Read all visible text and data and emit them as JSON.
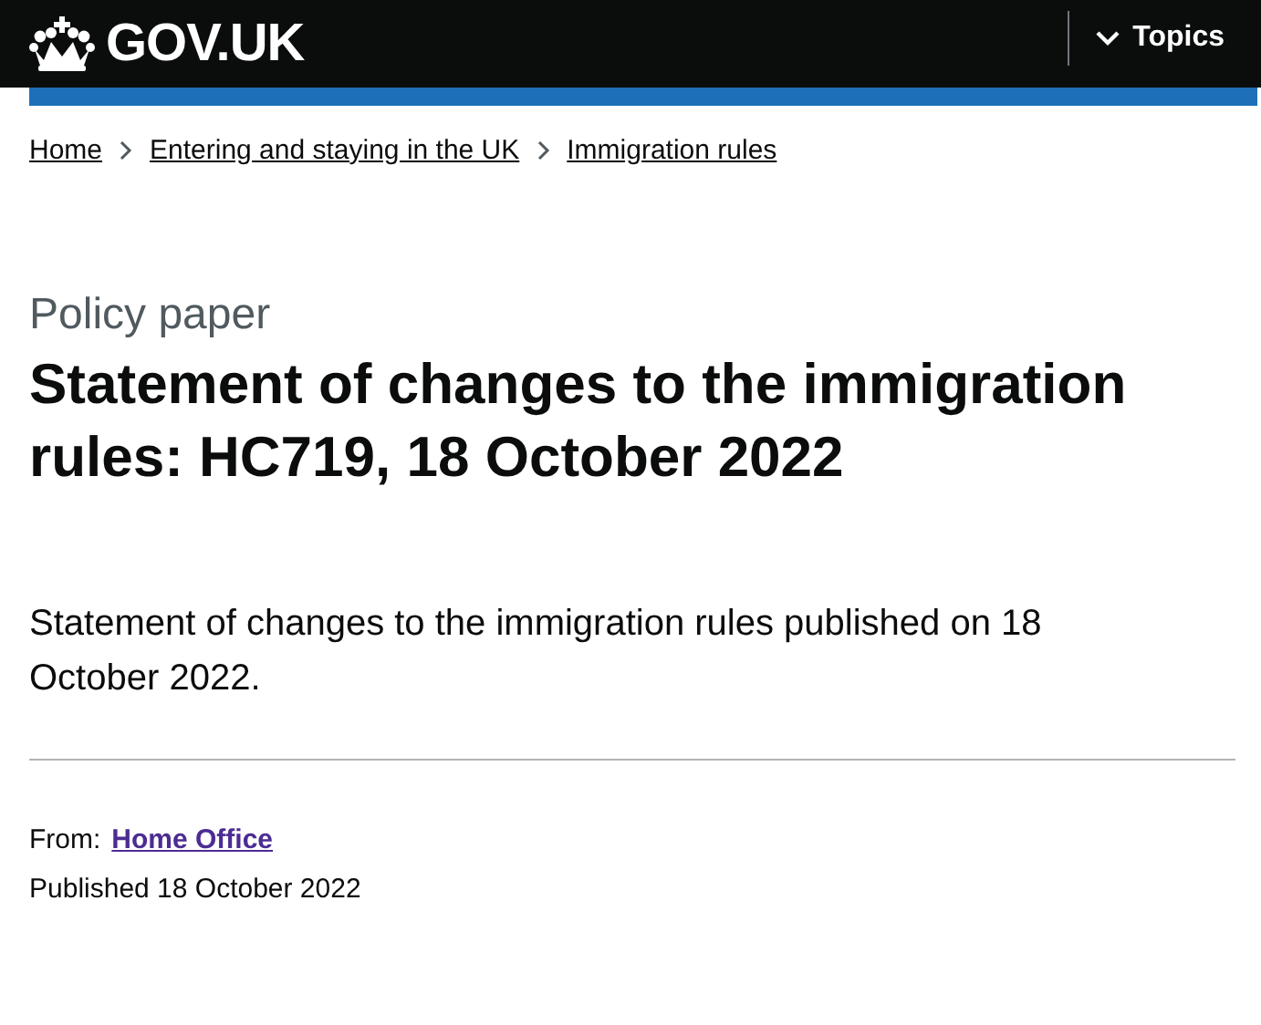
{
  "header": {
    "logo": "GOV.UK",
    "menu_button": "Topics"
  },
  "breadcrumbs": [
    "Home",
    "Entering and staying in the UK",
    "Immigration rules"
  ],
  "caption": "Policy paper",
  "title": "Statement of changes to the immigration rules: HC719, 18 October 2022",
  "lead": "Statement of changes to the immigration rules published on 18 October 2022.",
  "metadata": {
    "from_label": "From:",
    "from_link": "Home Office",
    "published": "Published 18 October 2022"
  }
}
